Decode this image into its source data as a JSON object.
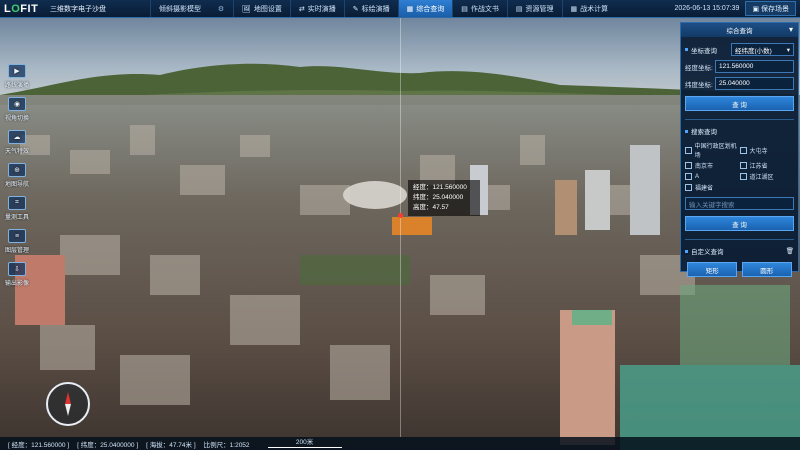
{
  "header": {
    "logo_prefix": "L",
    "logo_o": "O",
    "logo_rest": "FIT",
    "app_title": "三维数字电子沙盘",
    "tabs": [
      {
        "label": "倾斜摄影模型",
        "icon": ""
      },
      {
        "label": "地图设置",
        "icon": "🖼"
      },
      {
        "label": "实时演播",
        "icon": "⇄"
      },
      {
        "label": "标绘演播",
        "icon": "✎"
      },
      {
        "label": "综合查询",
        "icon": "▦"
      },
      {
        "label": "作战文书",
        "icon": "▤"
      },
      {
        "label": "资源管理",
        "icon": "▤"
      },
      {
        "label": "战术计算",
        "icon": "▦"
      }
    ],
    "active_tab": "综合查询",
    "datetime": "2026-06-13  15:07:39",
    "save_label": "保存场景"
  },
  "left_toolbar": {
    "items": [
      {
        "label": "路线演播",
        "icon": "▶"
      },
      {
        "label": "视角切换",
        "icon": "◉"
      },
      {
        "label": "天气特效",
        "icon": "☁"
      },
      {
        "label": "地图导航",
        "icon": "⊕"
      },
      {
        "label": "量测工具",
        "icon": "⌗"
      },
      {
        "label": "图层管理",
        "icon": "≡"
      },
      {
        "label": "输出影像",
        "icon": "⇩"
      }
    ]
  },
  "popup": {
    "lon": "经度：121.560000",
    "lat": "纬度：25.040000",
    "alt": "高度：47.57"
  },
  "panel": {
    "title": "综合查询",
    "close": "▾",
    "coord_section": "坐标查询",
    "coord_mode": "经纬度(小数)",
    "lon_label": "经度坐标:",
    "lon_value": "121.560000",
    "lat_label": "纬度坐标:",
    "lat_value": "25.040000",
    "query_btn": "查 询",
    "search_section": "搜索查询",
    "checks": [
      "中国行政区划机场",
      "大屯寺",
      "南京市",
      "江苏省",
      "A",
      "道江湖区",
      "福建省"
    ],
    "search_placeholder": "输入关键字搜索",
    "search_btn": "查 询",
    "custom_section": "自定义查询",
    "custom_icon": "🗑",
    "rect_btn": "矩形",
    "circle_btn": "圆形"
  },
  "statusbar": {
    "lon": "[ 经度：121.560000 ]",
    "lat": "[ 纬度：25.0400000 ]",
    "alt": "[ 海拔：47.74米 ]",
    "scale_ratio": "比例尺：1:2052",
    "scale_bar": "200米"
  }
}
